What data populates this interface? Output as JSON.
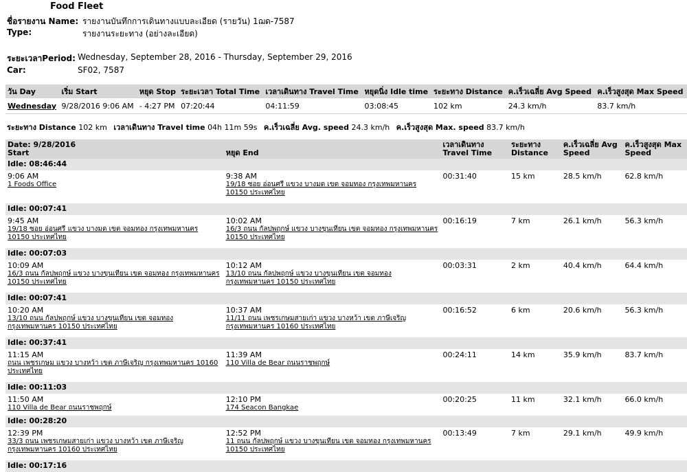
{
  "title": "Food Fleet",
  "report": {
    "name_label": "ชื่อรายงาน Name:",
    "name_value": "รายงานบันทึกการเดินทางแบบละเอียด (รายวัน) 1ฌด-7587",
    "type_label": "Type:",
    "type_value": "รายงานระยะทาง (อย่างละเอียด)",
    "period_label": "ระยะเวลาPeriod:",
    "period_value": "Wednesday, September 28, 2016 - Thursday, September 29, 2016",
    "car_label": "Car:",
    "car_value": "SF02, 7587"
  },
  "summary": {
    "headers": [
      "วัน Day",
      "เริ่ม Start",
      "หยุด Stop",
      "ระยะเวลา Total Time",
      "เวลาเดินทาง Travel Time",
      "หยุดนิ่ง Idle time",
      "ระยะทาง Distance",
      "ค.เร็วเฉลี่ย Avg Speed",
      "ค.เร็วสูงสุด Max Speed"
    ],
    "row": [
      "Wednesday",
      "9/28/2016 9:06 AM",
      "- 4:27 PM",
      "07:20:44",
      "04:11:59",
      "03:08:45",
      "102 km",
      "24.3 km/h",
      "83.7 km/h"
    ]
  },
  "totals": {
    "distance_label": "ระยะทาง Distance",
    "distance": "102 km",
    "travel_label": "เวลาเดินทาง Travel time",
    "travel": "04h 11m 59s",
    "avg_label": "ค.เร็วเฉลี่ย Avg. speed",
    "avg": "24.3 km/h",
    "max_label": "ค.เร็วสูงสุด Max. speed",
    "max": "83.7 km/h"
  },
  "detail": {
    "date_header": "Date: 9/28/2016",
    "headers": {
      "start": "Start",
      "end": "หยุด End",
      "travel": "เวลาเดินทาง Travel Time",
      "distance": "ระยะทาง Distance",
      "avg": "ค.เร็วเฉลี่ย Avg Speed",
      "max": "ค.เร็วสูงสุด Max Speed"
    },
    "rows": [
      {
        "idle": "Idle: 08:46:44"
      },
      {
        "start_time": "9:06 AM",
        "start_addr": "1 Foods Office",
        "end_time": "9:38 AM",
        "end_addr": "19/18 ซอย อ่อนศรี แขวง บางมด เขต จอมทอง กรุงเทพมหานคร 10150 ประเทศไทย",
        "travel": "00:31:40",
        "distance": "15 km",
        "avg": "28.5 km/h",
        "max": "62.8 km/h"
      },
      {
        "idle": "Idle: 00:07:41"
      },
      {
        "start_time": "9:45 AM",
        "start_addr": "19/18 ซอย อ่อนศรี แขวง บางมด เขต จอมทอง กรุงเทพมหานคร 10150 ประเทศไทย",
        "end_time": "10:02 AM",
        "end_addr": "16/3 ถนน กัลปพฤกษ์ แขวง บางขุนเทียน เขต จอมทอง กรุงเทพมหานคร 10150 ประเทศไทย",
        "travel": "00:16:19",
        "distance": "7 km",
        "avg": "26.1 km/h",
        "max": "56.3 km/h"
      },
      {
        "idle": "Idle: 00:07:03"
      },
      {
        "start_time": "10:09 AM",
        "start_addr": "16/3 ถนน กัลปพฤกษ์ แขวง บางขุนเทียน เขต จอมทอง กรุงเทพมหานคร 10150 ประเทศไทย",
        "end_time": "10:12 AM",
        "end_addr": "13/10 ถนน กัลปพฤกษ์ แขวง บางขุนเทียน เขต จอมทอง กรุงเทพมหานคร 10150 ประเทศไทย",
        "travel": "00:03:31",
        "distance": "2 km",
        "avg": "40.4 km/h",
        "max": "64.4 km/h"
      },
      {
        "idle": "Idle: 00:07:41"
      },
      {
        "start_time": "10:20 AM",
        "start_addr": "13/10 ถนน กัลปพฤกษ์ แขวง บางขุนเทียน เขต จอมทอง กรุงเทพมหานคร 10150 ประเทศไทย",
        "end_time": "10:37 AM",
        "end_addr": "11/11 ถนน เพชรเกษมสายเก่า แขวง บางหว้า เขต ภาษีเจริญ กรุงเทพมหานคร 10160 ประเทศไทย",
        "travel": "00:16:52",
        "distance": "6 km",
        "avg": "20.6 km/h",
        "max": "56.3 km/h"
      },
      {
        "idle": "Idle: 00:37:41"
      },
      {
        "start_time": "11:15 AM",
        "start_addr": "ถนน เพชรเกษม แขวง บางหว้า เขต ภาษีเจริญ กรุงเทพมหานคร 10160 ประเทศไทย",
        "end_time": "11:39 AM",
        "end_addr": "110 Villa de Bear ถนนราชพฤกษ์",
        "travel": "00:24:11",
        "distance": "14 km",
        "avg": "35.9 km/h",
        "max": "83.7 km/h"
      },
      {
        "idle": "Idle: 00:11:03"
      },
      {
        "start_time": "11:50 AM",
        "start_addr": "110 Villa de Bear ถนนราชพฤกษ์",
        "end_time": "12:10 PM",
        "end_addr": "174 Seacon Bangkae",
        "travel": "00:20:25",
        "distance": "11 km",
        "avg": "32.1 km/h",
        "max": "66.0 km/h",
        "short": true
      },
      {
        "idle": "Idle: 00:28:20"
      },
      {
        "start_time": "12:39 PM",
        "start_addr": "33/3 ถนน เพชรเกษมสายเก่า แขวง บางหว้า เขต ภาษีเจริญ กรุงเทพมหานคร 10160 ประเทศไทย",
        "end_time": "12:52 PM",
        "end_addr": "11 ถนน กัลปพฤกษ์ แขวง บางขุนเทียน เขต จอมทอง กรุงเทพมหานคร 10150 ประเทศไทย",
        "travel": "00:13:49",
        "distance": "7 km",
        "avg": "29.1 km/h",
        "max": "49.9 km/h"
      },
      {
        "idle": "Idle: 00:17:16"
      }
    ]
  }
}
